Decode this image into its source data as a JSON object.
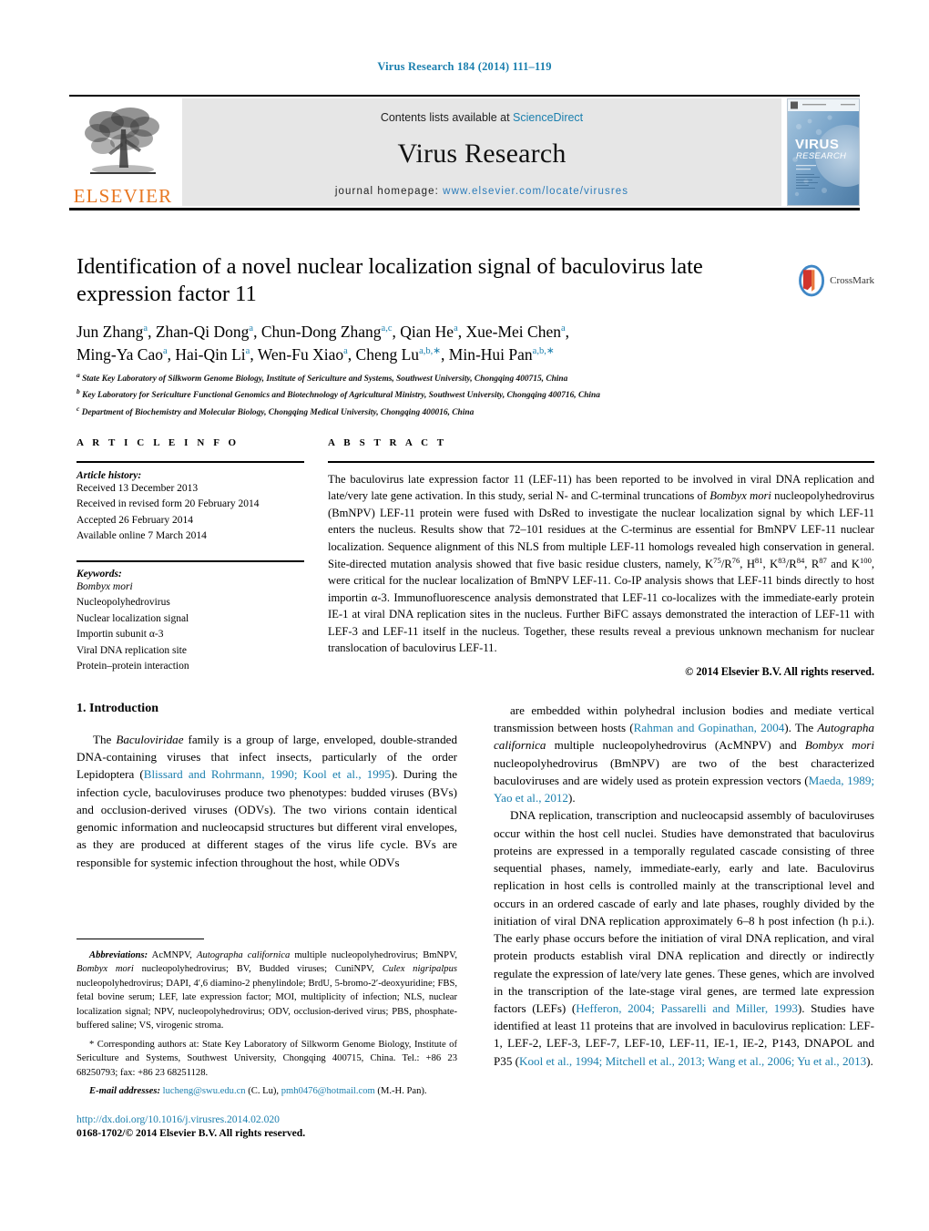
{
  "running_head": "Virus Research 184 (2014) 111–119",
  "masthead": {
    "contents_prefix": "Contents lists available at ",
    "sciencedirect": "ScienceDirect",
    "journal_name": "Virus Research",
    "homepage_prefix": "journal homepage: ",
    "homepage_url": "www.elsevier.com/locate/virusres",
    "publisher_logo_text": "ELSEVIER",
    "cover_title_line1": "VIRUS",
    "cover_title_line2": "RESEARCH",
    "accent_color": "#1a7fae",
    "elsevier_orange": "#E87722"
  },
  "article": {
    "title": "Identification of a novel nuclear localization signal of baculovirus late expression factor 11",
    "crossmark_label": "CrossMark",
    "authors_line1": [
      {
        "name": "Jun Zhang",
        "sup": "a"
      },
      {
        "name": "Zhan-Qi Dong",
        "sup": "a"
      },
      {
        "name": "Chun-Dong Zhang",
        "sup": "a,c"
      },
      {
        "name": "Qian He",
        "sup": "a"
      },
      {
        "name": "Xue-Mei Chen",
        "sup": "a"
      }
    ],
    "authors_line2": [
      {
        "name": "Ming-Ya Cao",
        "sup": "a"
      },
      {
        "name": "Hai-Qin Li",
        "sup": "a"
      },
      {
        "name": "Wen-Fu Xiao",
        "sup": "a"
      },
      {
        "name": "Cheng Lu",
        "sup": "a,b,∗"
      },
      {
        "name": "Min-Hui Pan",
        "sup": "a,b,∗"
      }
    ],
    "affiliations": [
      {
        "mark": "a",
        "text": "State Key Laboratory of Silkworm Genome Biology, Institute of Sericulture and Systems, Southwest University, Chongqing 400715, China"
      },
      {
        "mark": "b",
        "text": "Key Laboratory for Sericulture Functional Genomics and Biotechnology of Agricultural Ministry, Southwest University, Chongqing 400716, China"
      },
      {
        "mark": "c",
        "text": "Department of Biochemistry and Molecular Biology, Chongqing Medical University, Chongqing 400016, China"
      }
    ]
  },
  "article_info": {
    "heading": "A R T I C L E    I N F O",
    "history_label": "Article history:",
    "history": [
      "Received 13 December 2013",
      "Received in revised form 20 February 2014",
      "Accepted 26 February 2014",
      "Available online 7 March 2014"
    ],
    "keywords_label": "Keywords:",
    "keywords": [
      {
        "text": "Bombyx mori",
        "italic": true
      },
      {
        "text": "Nucleopolyhedrovirus",
        "italic": false
      },
      {
        "text": "Nuclear localization signal",
        "italic": false
      },
      {
        "text": "Importin subunit α-3",
        "italic": false
      },
      {
        "text": "Viral DNA replication site",
        "italic": false
      },
      {
        "text": "Protein–protein interaction",
        "italic": false
      }
    ]
  },
  "abstract": {
    "heading": "A B S T R A C T",
    "body_html": "The baculovirus late expression factor 11 (LEF-11) has been reported to be involved in viral DNA replication and late/very late gene activation. In this study, serial N- and C-terminal truncations of <i>Bombyx mori</i> nucleopolyhedrovirus (BmNPV) LEF-11 protein were fused with DsRed to investigate the nuclear localization signal by which LEF-11 enters the nucleus. Results show that 72–101 residues at the C-terminus are essential for BmNPV LEF-11 nuclear localization. Sequence alignment of this NLS from multiple LEF-11 homologs revealed high conservation in general. Site-directed mutation analysis showed that five basic residue clusters, namely, K<sup>75</sup>/R<sup>76</sup>, H<sup>81</sup>, K<sup>83</sup>/R<sup>84</sup>, R<sup>87</sup> and K<sup>100</sup>, were critical for the nuclear localization of BmNPV LEF-11. Co-IP analysis shows that LEF-11 binds directly to host importin α-3. Immunofluorescence analysis demonstrated that LEF-11 co-localizes with the immediate-early protein IE-1 at viral DNA replication sites in the nucleus. Further BiFC assays demonstrated the interaction of LEF-11 with LEF-3 and LEF-11 itself in the nucleus. Together, these results reveal a previous unknown mechanism for nuclear translocation of baculovirus LEF-11.",
    "rights": "© 2014 Elsevier B.V. All rights reserved."
  },
  "body": {
    "section_heading": "1.  Introduction",
    "left_paragraphs_html": [
      "The <i>Baculoviridae</i> family is a group of large, enveloped, double-stranded DNA-containing viruses that infect insects, particularly of the order Lepidoptera (<span class=\"ref\">Blissard and Rohrmann, 1990; Kool et al., 1995</span>). During the infection cycle, baculoviruses produce two phenotypes: budded viruses (BVs) and occlusion-derived viruses (ODVs). The two virions contain identical genomic information and nucleocapsid structures but different viral envelopes, as they are produced at different stages of the virus life cycle. BVs are responsible for systemic infection throughout the host, while ODVs"
    ],
    "right_paragraphs_html": [
      "are embedded within polyhedral inclusion bodies and mediate vertical transmission between hosts (<span class=\"ref\">Rahman and Gopinathan, 2004</span>). The <i>Autographa californica</i> multiple nucleopolyhedrovirus (AcMNPV) and <i>Bombyx mori</i> nucleopolyhedrovirus (BmNPV) are two of the best characterized baculoviruses and are widely used as protein expression vectors (<span class=\"ref\">Maeda, 1989; Yao et al., 2012</span>).",
      "DNA replication, transcription and nucleocapsid assembly of baculoviruses occur within the host cell nuclei. Studies have demonstrated that baculovirus proteins are expressed in a temporally regulated cascade consisting of three sequential phases, namely, immediate-early, early and late. Baculovirus replication in host cells is controlled mainly at the transcriptional level and occurs in an ordered cascade of early and late phases, roughly divided by the initiation of viral DNA replication approximately 6–8 h post infection (h p.i.). The early phase occurs before the initiation of viral DNA replication, and viral protein products establish viral DNA replication and directly or indirectly regulate the expression of late/very late genes. These genes, which are involved in the transcription of the late-stage viral genes, are termed late expression factors (LEFs) (<span class=\"ref\">Hefferon, 2004; Passarelli and Miller, 1993</span>). Studies have identified at least 11 proteins that are involved in baculovirus replication: LEF-1, LEF-2, LEF-3, LEF-7, LEF-10, LEF-11, IE-1, IE-2, P143, DNAPOL and P35 (<span class=\"ref\">Kool et al., 1994; Mitchell et al., 2013; Wang et al., 2006; Yu et al., 2013</span>)."
    ]
  },
  "footnotes": {
    "abbreviations_html": "<span class=\"lbl\">Abbreviations:</span> AcMNPV, <i>Autographa californica</i> multiple nucleopolyhedrovirus; BmNPV, <i>Bombyx mori</i> nucleopolyhedrovirus; BV, Budded viruses; CuniNPV, <i>Culex nigripalpus</i> nucleopolyhedrovirus; DAPI, 4′,6 diamino-2 phenylindole; BrdU, 5-bromo-2′-deoxyuridine; FBS, fetal bovine serum; LEF, late expression factor; MOI, multiplicity of infection; NLS, nuclear localization signal; NPV, nucleopolyhedrovirus; ODV, occlusion-derived virus; PBS, phosphate-buffered saline; VS, virogenic stroma.",
    "corresponding_html": "* Corresponding authors at: State Key Laboratory of Silkworm Genome Biology, Institute of Sericulture and Systems, Southwest University, Chongqing 400715, China. Tel.: +86 23 68250793; fax: +86 23 68251128.",
    "email_html": "<span class=\"lbl\">E-mail addresses:</span> <span class=\"mail\">lucheng@swu.edu.cn</span> (C. Lu), <span class=\"mail\">pmh0476@hotmail.com</span> (M.-H. Pan).",
    "doi": "http://dx.doi.org/10.1016/j.virusres.2014.02.020",
    "issn_line": "0168-1702/© 2014 Elsevier B.V. All rights reserved."
  }
}
